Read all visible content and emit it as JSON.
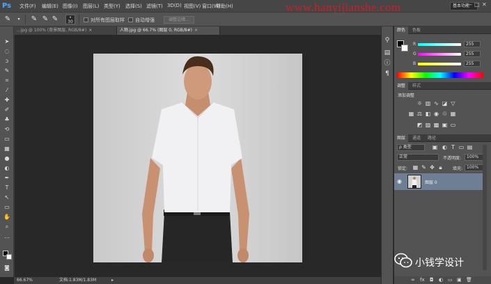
{
  "app": {
    "logo": "Ps",
    "menu": [
      "文件(F)",
      "编辑(E)",
      "图像(I)",
      "图层(L)",
      "类型(Y)",
      "选择(S)",
      "滤镜(T)",
      "3D(D)",
      "视图(V)",
      "窗口(W)",
      "帮助(H)"
    ],
    "watermark": "www.hanyijianshe.com",
    "workspace": "基本功能",
    "window_controls": [
      "—",
      "□",
      "✕"
    ]
  },
  "options": {
    "brush_size": "30",
    "sample_all_layers": "对所有图层取样",
    "auto_enhance": "自动增强",
    "refine_edge": "调整边缘..."
  },
  "tabs": [
    {
      "label": "...jpg @ 100% (背景图层, RGB/8#)",
      "close": "×"
    },
    {
      "label": "人物.jpg @ 66.7% (图层 0, RGB/8#)",
      "close": "×"
    }
  ],
  "status": {
    "zoom": "66.67%",
    "doc": "文档:1.83M/1.83M",
    "arrow": "▸"
  },
  "panels": {
    "color": {
      "tabs": [
        "颜色",
        "色板"
      ],
      "channels": [
        {
          "label": "R",
          "value": "255"
        },
        {
          "label": "G",
          "value": "255"
        },
        {
          "label": "B",
          "value": "255"
        }
      ]
    },
    "adjustments": {
      "tabs": [
        "调整",
        "样式"
      ],
      "title": "添加调整"
    },
    "layers": {
      "tabs": [
        "图层",
        "通道",
        "路径"
      ],
      "filter": "ρ 类型",
      "blend_mode": "正常",
      "opacity_label": "不透明度:",
      "opacity_value": "100%",
      "lock_label": "锁定:",
      "fill_label": "填充:",
      "fill_value": "100%",
      "items": [
        {
          "name": "图层 0",
          "visible": true
        }
      ]
    }
  },
  "overlay": {
    "wechat_text": "小钱学设计"
  },
  "colors": {
    "accent": "#4ea6ff",
    "watermark": "#c8202a",
    "selected_layer": "#6e7f95"
  }
}
